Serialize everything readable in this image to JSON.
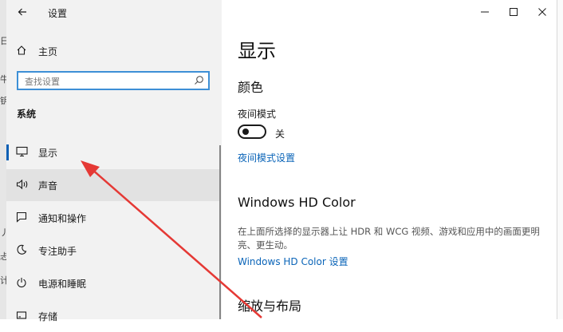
{
  "window": {
    "title": "设置"
  },
  "behind_strip": [
    "日",
    "牛",
    "钥",
    "丿",
    "忐",
    "计"
  ],
  "nav": {
    "home_label": "主页",
    "search_placeholder": "查找设置",
    "section": "系统",
    "items": [
      {
        "label": "显示",
        "icon": "monitor-icon",
        "selected": true
      },
      {
        "label": "声音",
        "icon": "speaker-icon",
        "selected": false
      },
      {
        "label": "通知和操作",
        "icon": "notification-icon",
        "selected": false
      },
      {
        "label": "专注助手",
        "icon": "moon-icon",
        "selected": false
      },
      {
        "label": "电源和睡眠",
        "icon": "power-icon",
        "selected": false
      },
      {
        "label": "存储",
        "icon": "storage-icon",
        "selected": false
      }
    ]
  },
  "main": {
    "page_title": "显示",
    "color_heading": "颜色",
    "night_mode_label": "夜间模式",
    "night_mode_state": "关",
    "night_mode_on": false,
    "night_mode_link": "夜间模式设置",
    "hdr_heading": "Windows HD Color",
    "hdr_desc": "在上面所选择的显示器上让 HDR 和 WCG 视频、游戏和应用中的画面更明亮、更生动。",
    "hdr_link": "Windows HD Color 设置",
    "scale_heading": "缩放与布局"
  },
  "colors": {
    "accent": "#0a5fb4",
    "link": "#0a64b8",
    "annotation_arrow": "#e53935"
  }
}
